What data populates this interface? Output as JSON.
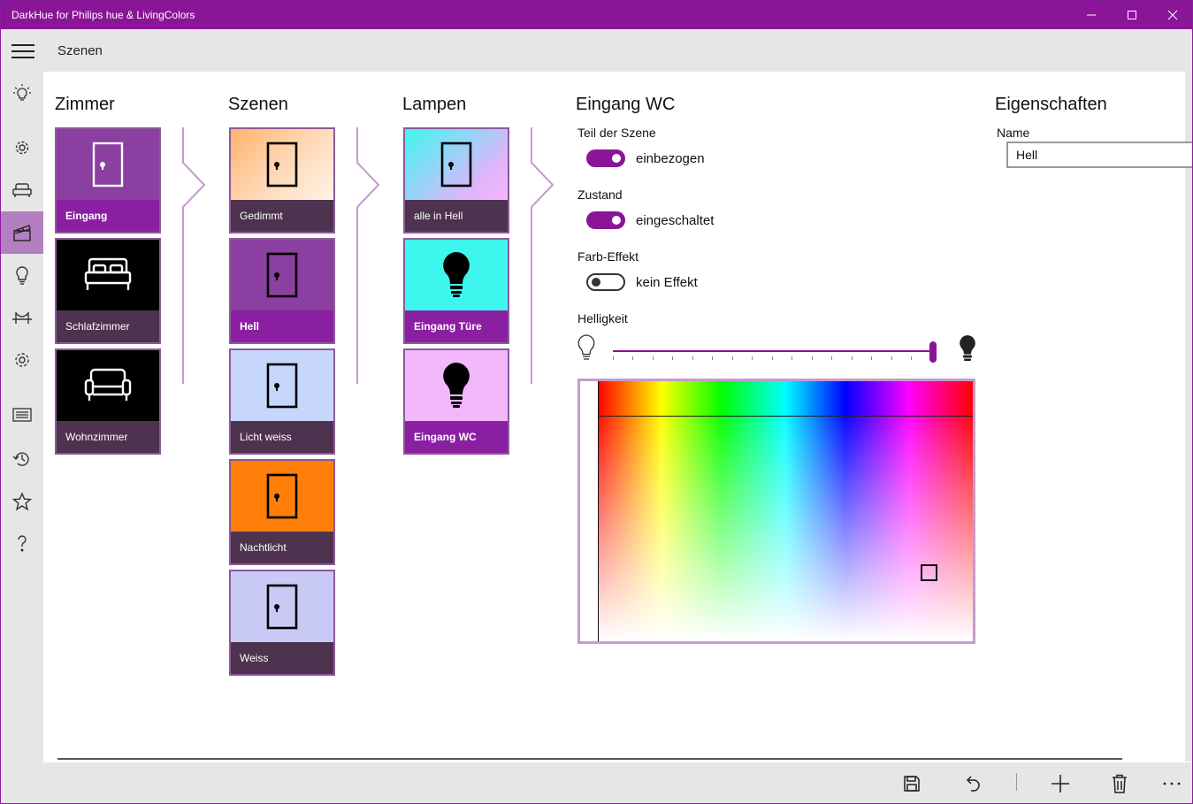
{
  "window": {
    "title": "DarkHue for Philips hue & LivingColors",
    "minimize": "minimize",
    "maximize": "maximize",
    "close": "close"
  },
  "header": {
    "title": "Szenen"
  },
  "nav": {
    "items": [
      {
        "icon": "lightbulb-rays-icon"
      },
      {
        "icon": "gear-icon"
      },
      {
        "icon": "sofa-icon"
      },
      {
        "icon": "clapperboard-icon",
        "active": true
      },
      {
        "icon": "lightbulb-icon"
      },
      {
        "icon": "bridge-icon"
      },
      {
        "icon": "settings-icon"
      },
      {
        "icon": "list-icon"
      },
      {
        "icon": "history-icon"
      },
      {
        "icon": "star-icon"
      },
      {
        "icon": "help-icon"
      }
    ]
  },
  "columns": {
    "rooms": {
      "title": "Zimmer",
      "items": [
        {
          "label": "Eingang",
          "bg": "#8b3fa0",
          "icon": "door-icon",
          "selected": true
        },
        {
          "label": "Schlafzimmer",
          "bg": "#000000",
          "icon": "bed-icon"
        },
        {
          "label": "Wohnzimmer",
          "bg": "#000000",
          "icon": "sofa-icon"
        }
      ]
    },
    "scenes": {
      "title": "Szenen",
      "items": [
        {
          "label": "Gedimmt",
          "bg": "gradient-peach",
          "icon": "door-icon"
        },
        {
          "label": "Hell",
          "bg": "#8b3fa0",
          "icon": "door-icon",
          "selected": true
        },
        {
          "label": "Licht weiss",
          "bg": "#c7d7fb",
          "icon": "door-icon"
        },
        {
          "label": "Nachtlicht",
          "bg": "#ff7f0a",
          "icon": "door-icon"
        },
        {
          "label": "Weiss",
          "bg": "#c9c9f6",
          "icon": "door-icon"
        }
      ]
    },
    "lamps": {
      "title": "Lampen",
      "items": [
        {
          "label": "alle in Hell",
          "bg": "gradient-cyan-pink",
          "icon": "door-icon"
        },
        {
          "label": "Eingang Türe",
          "bg": "#3df7ef",
          "icon": "bulb-icon",
          "selected": true
        },
        {
          "label": "Eingang WC",
          "bg": "#f3b7fb",
          "icon": "bulb-icon",
          "selected": true
        }
      ]
    }
  },
  "detail": {
    "title": "Eingang WC",
    "part_of_scene": {
      "label": "Teil der Szene",
      "value": "einbezogen",
      "on": true
    },
    "state": {
      "label": "Zustand",
      "value": "eingeschaltet",
      "on": true
    },
    "color_effect": {
      "label": "Farb-Effekt",
      "value": "kein Effekt",
      "on": false
    },
    "brightness": {
      "label": "Helligkeit",
      "value_fraction": 0.99
    }
  },
  "properties": {
    "title": "Eigenschaften",
    "name_label": "Name",
    "name_value": "Hell"
  },
  "commands": {
    "save": "save-icon",
    "undo": "undo-icon",
    "add": "add-icon",
    "delete": "delete-icon",
    "more": "more-icon"
  },
  "colors": {
    "accent": "#8b1596",
    "tile_label": "#4d334f",
    "tile_label_selected": "#8b1fa2",
    "chrome": "#e6e6e6"
  }
}
